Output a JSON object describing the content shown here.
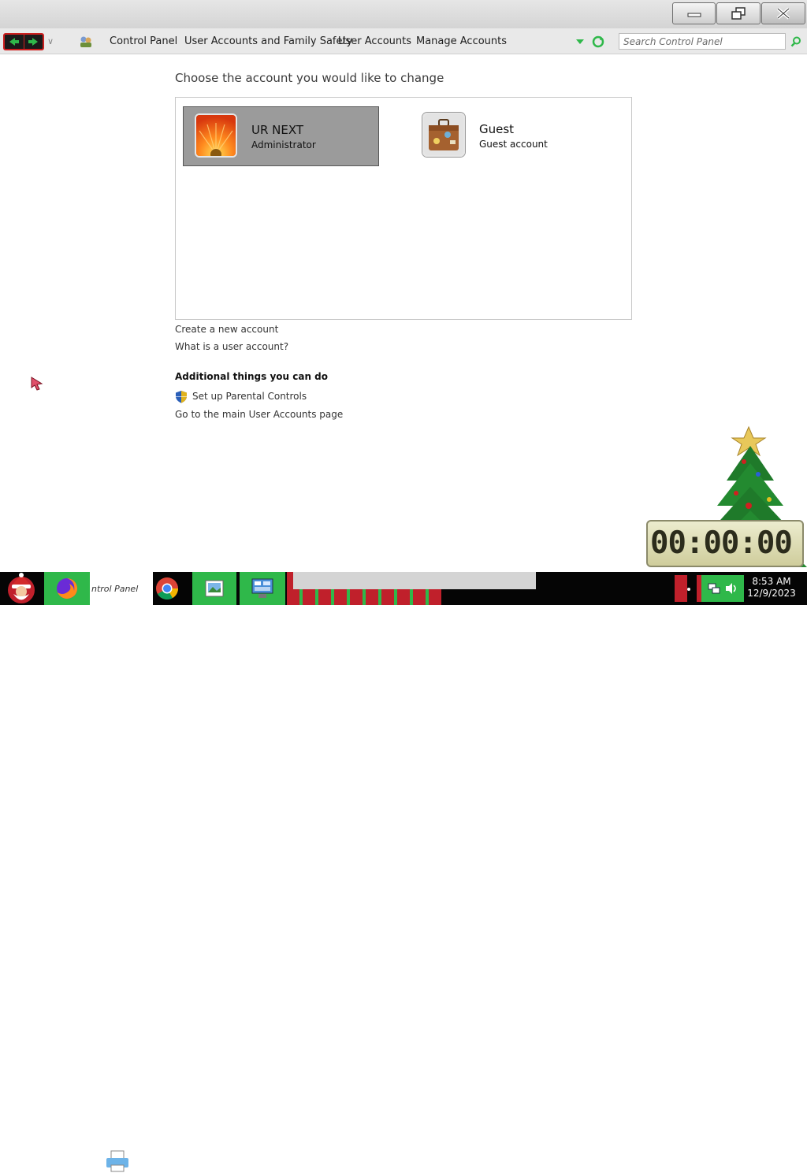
{
  "window": {
    "buttons": {
      "minimize": "minimize",
      "restore": "restore",
      "close": "close"
    }
  },
  "address_bar": {
    "breadcrumbs": [
      "Control Panel",
      "User Accounts and Family Safety",
      "User Accounts",
      "Manage Accounts"
    ],
    "search_placeholder": "Search Control Panel"
  },
  "main": {
    "title": "Choose the account you would like to change",
    "accounts": [
      {
        "name": "UR NEXT",
        "role": "Administrator",
        "icon": "flower-avatar-icon",
        "selected": true
      },
      {
        "name": "Guest",
        "role": "Guest account",
        "icon": "suitcase-avatar-icon",
        "selected": false
      }
    ],
    "links": {
      "create": "Create a new account",
      "what_is": "What is a user account?"
    },
    "additional": {
      "heading": "Additional things you can do",
      "parental": "Set up Parental Controls",
      "main_page": "Go to the main User Accounts page"
    }
  },
  "taskbar": {
    "partial_label": "ntrol Panel",
    "clock_time": "8:53 AM",
    "clock_date": "12/9/2023"
  },
  "desktop_widget": {
    "timer": "00:00:00"
  },
  "colors": {
    "selected_account_bg": "#9b9b9b",
    "taskbar_green": "#2fb84a",
    "taskbar_red": "#c0202b"
  }
}
